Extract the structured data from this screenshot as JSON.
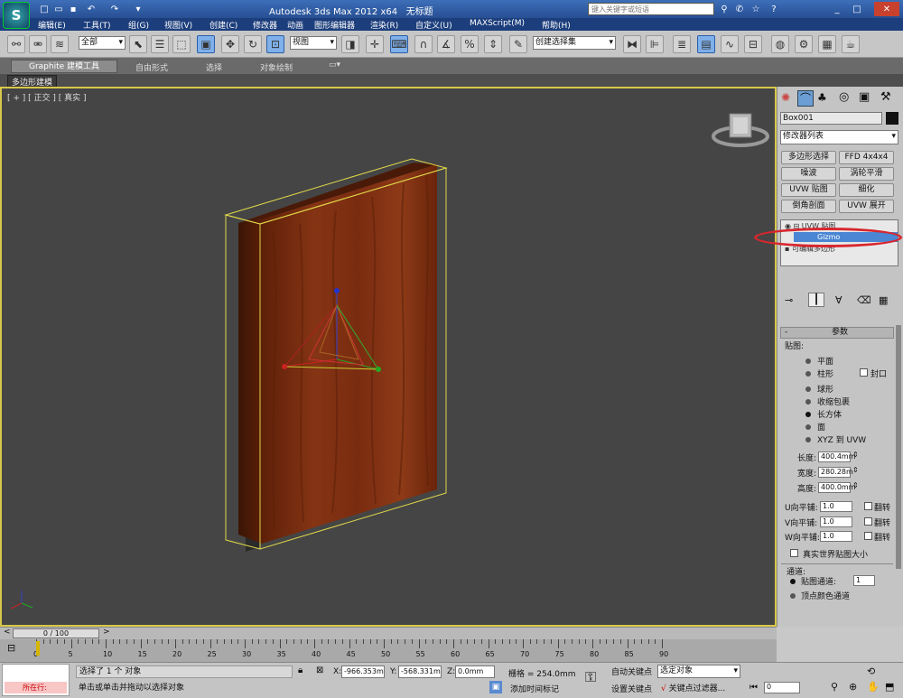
{
  "window": {
    "title": "Autodesk 3ds Max  2012 x64",
    "doc": "无标题",
    "search_placeholder": "键入关键字或短语"
  },
  "menu": [
    "编辑(E)",
    "工具(T)",
    "组(G)",
    "视图(V)",
    "创建(C)",
    "修改器",
    "动画",
    "图形编辑器",
    "渲染(R)",
    "自定义(U)",
    "MAXScript(M)",
    "帮助(H)"
  ],
  "toolbar": {
    "selection_filter": "全部",
    "ref_coord": "视图",
    "named_selection": "创建选择集"
  },
  "ribbon": {
    "tabs": [
      "Graphite 建模工具",
      "自由形式",
      "选择",
      "对象绘制"
    ],
    "sub": "多边形建模"
  },
  "viewport": {
    "label": [
      "[ + ]",
      "[ 正交 ]",
      "[ 真实 ]"
    ]
  },
  "panel": {
    "object_name": "Box001",
    "modifier_list": "修改器列表",
    "buttons": [
      "多边形选择",
      "FFD 4x4x4",
      "噪波",
      "涡轮平滑",
      "UVW 贴图",
      "细化",
      "倒角剖面",
      "UVW 展开"
    ],
    "stack": [
      "UVW 贴图",
      "Gizmo",
      "可编辑多边形"
    ],
    "rollout_title": "参数",
    "mapping_label": "贴图:",
    "mapping": [
      "平面",
      "柱形",
      "球形",
      "收缩包裹",
      "长方体",
      "面",
      "XYZ 到 UVW"
    ],
    "mapping_selected": 4,
    "cap": "封口",
    "dims": [
      {
        "label": "长度:",
        "value": "400.4mm"
      },
      {
        "label": "宽度:",
        "value": "280.28m"
      },
      {
        "label": "高度:",
        "value": "400.0mm"
      }
    ],
    "tiles": [
      {
        "label": "U向平铺:",
        "value": "1.0"
      },
      {
        "label": "V向平铺:",
        "value": "1.0"
      },
      {
        "label": "W向平铺:",
        "value": "1.0"
      }
    ],
    "flip": "翻转",
    "real_world": "真实世界贴图大小",
    "channel_label": "通道:",
    "map_channel": "贴图通道:",
    "map_channel_value": "1",
    "vertex_color": "顶点颜色通道"
  },
  "timeline": {
    "frame": "0 / 100",
    "ticks": [
      "0",
      "5",
      "10",
      "15",
      "20",
      "25",
      "30",
      "35",
      "40",
      "45",
      "50",
      "55",
      "60",
      "65",
      "70",
      "75",
      "80",
      "85",
      "90"
    ]
  },
  "status": {
    "selected": "选择了 1 个 对象",
    "hint": "单击或单击并拖动以选择对象",
    "now": "所在行:",
    "x_label": "X:",
    "x": "-966.353m",
    "y_label": "Y:",
    "y": "-568.331m",
    "z_label": "Z:",
    "z": "0.0mm",
    "grid": "栅格 = 254.0mm",
    "auto_key": "自动关键点",
    "selected_obj": "选定对象",
    "set_key": "设置关键点",
    "key_filter": "关键点过滤器...",
    "add_time_tag": "添加时间标记",
    "frame": "0"
  },
  "colors": {
    "viewport_bg": "#454545",
    "selection_box": "#e0d84a",
    "wood": "#7a2e10",
    "highlight": "#d8262e"
  }
}
